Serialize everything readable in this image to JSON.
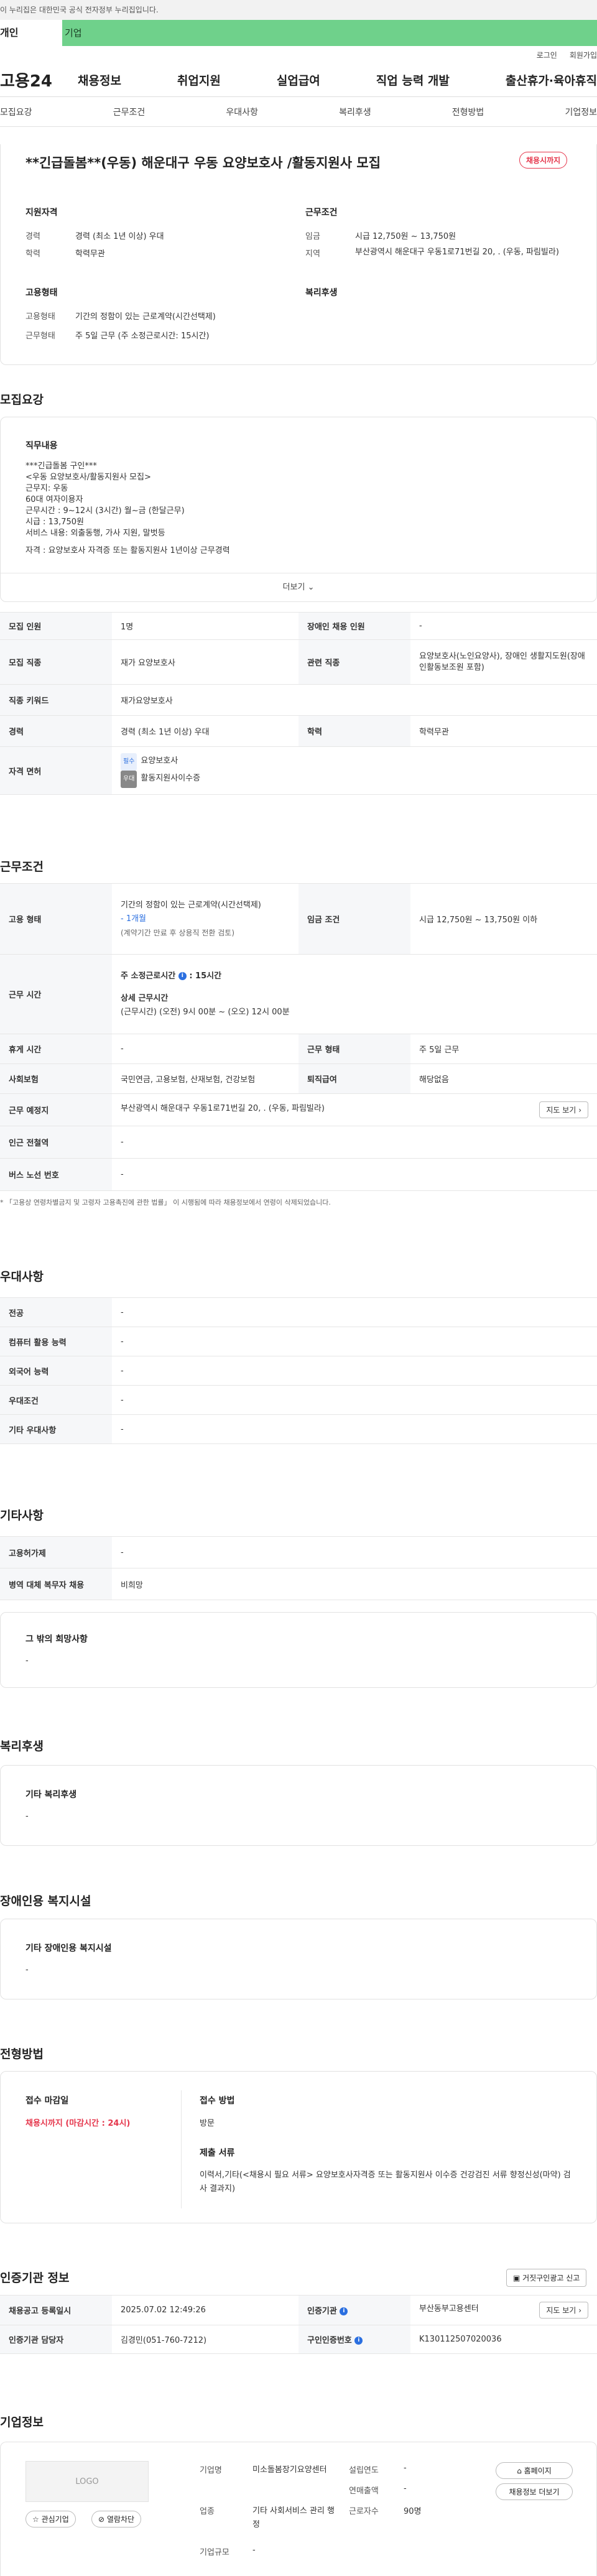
{
  "banner": {
    "text": "이 누리집은 대한민국 공식 전자정부 누리집입니다."
  },
  "tabs": {
    "personal": "개인",
    "company": "기업"
  },
  "util": {
    "login": "로그인",
    "join": "회원가입"
  },
  "gnb": {
    "logo": "고용24",
    "items": [
      "채용정보",
      "취업지원",
      "실업급여",
      "직업 능력 개발",
      "출산휴가·육아휴직"
    ]
  },
  "subtabs": [
    "모집요강",
    "근무조건",
    "우대사항",
    "복리후생",
    "전형방법",
    "기업정보"
  ],
  "job": {
    "title": "**긴급돌봄**(우동) 해운대구 우동 요양보호사 /활동지원사 모집",
    "status_badge": "채용시까지",
    "qual_head": "지원자격",
    "career_lbl": "경력",
    "career_val": "경력 (최소 1년 이상) 우대",
    "edu_lbl": "학력",
    "edu_val": "학력무관",
    "cond_head": "근무조건",
    "wage_lbl": "임금",
    "wage_val": "시급 12,750원 ~ 13,750원",
    "area_lbl": "지역",
    "area_val": "부산광역시 해운대구 우동1로71번길 20, . (우동, 파림빌라)",
    "emp_head": "고용형태",
    "emptype_lbl": "고용형태",
    "emptype_val": "기간의 정함이 있는 근로계약(시간선택제)",
    "worktype_lbl": "근무형태",
    "worktype_val": "주 5일 근무 (주 소정근로시간: 15시간)",
    "welfare_head": "복리후생"
  },
  "recruit": {
    "section_title": "모집요강",
    "duty_head": "직무내용",
    "duty_lines": [
      "***긴급돌봄 구인***",
      "<우동 요양보호사/활동지원사 모집>",
      "근무지: 우동",
      "60대 여자이용자",
      "근무시간 : 9~12시 (3시간) 월~금 (한달근무)",
      "시급 : 13,750원",
      "서비스 내용: 외출동행, 가사 지원,  말벗등",
      "",
      "자격 : 요양보호사 자격증 또는 활동지원사 1년이상 근무경력"
    ],
    "more": "더보기",
    "rows": {
      "count_lbl": "모집 인원",
      "count_val": "1명",
      "disabled_lbl": "장애인 채용 인원",
      "disabled_val": "-",
      "job_lbl": "모집 직종",
      "job_val": "재가 요양보호사",
      "related_lbl": "관련 직종",
      "related_val": "요양보호사(노인요양사), 장애인 생활지도원(장애인활동보조원 포함)",
      "keyword_lbl": "직종 키워드",
      "keyword_val": "재가요양보호사",
      "career_lbl": "경력",
      "career_val": "경력 (최소 1년 이상) 우대",
      "edu_lbl": "학력",
      "edu_val": "학력무관",
      "license_lbl": "자격 면허",
      "license_chip1": "필수",
      "license_val1": "요양보호사",
      "license_chip2": "우대",
      "license_val2": "활동지원사이수증"
    }
  },
  "conditions": {
    "section_title": "근무조건",
    "emp_lbl": "고용 형태",
    "emp_val1": "기간의 정함이 있는 근로계약(시간선택제)",
    "emp_val2": "- 1개월",
    "emp_val3": "(계약기간 만료 후 상용직 전환 검토)",
    "wage_lbl": "임금 조건",
    "wage_val": "시급 12,750원 ~ 13,750원 이하",
    "time_lbl": "근무 시간",
    "time_week": "주 소정근로시간",
    "time_week_val": ": 15시간",
    "time_detail_head": "상세 근무시간",
    "time_detail": "(근무시간) (오전) 9시 00분 ~ (오오) 12시 00분",
    "rest_lbl": "휴게 시간",
    "rest_val": "-",
    "form_lbl": "근무 형태",
    "form_val": "주 5일 근무",
    "insurance_lbl": "사회보험",
    "insurance_val": "국민연금, 고용보험, 산재보험, 건강보험",
    "retire_lbl": "퇴직급여",
    "retire_val": "해당없음",
    "place_lbl": "근무 예정지",
    "place_val": "부산광역시 해운대구 우동1로71번길 20, . (우동, 파림빌라)",
    "map_btn": "지도 보기",
    "station_lbl": "인근 전철역",
    "station_val": "-",
    "bus_lbl": "버스 노선 번호",
    "bus_val": "-",
    "note": "* 「고용상 연령차별금지 및 고령자 고용촉진에 관한 법률」 이 시행됨에 따라 채용정보에서 연령이 삭제되었습니다."
  },
  "preferences": {
    "section_title": "우대사항",
    "rows": [
      {
        "label": "전공",
        "value": "-"
      },
      {
        "label": "컴퓨터 활용 능력",
        "value": "-"
      },
      {
        "label": "외국어 능력",
        "value": "-"
      },
      {
        "label": "우대조건",
        "value": "-"
      },
      {
        "label": "기타 우대사항",
        "value": "-"
      }
    ]
  },
  "etc": {
    "section_title": "기타사항",
    "rows": [
      {
        "label": "고용허가제",
        "value": "-"
      },
      {
        "label": "병역 대체 복무자 채용",
        "value": "비희망"
      }
    ],
    "hope_head": "그 밖의 희망사항",
    "hope_val": "-"
  },
  "welfare": {
    "section_title": "복리후생",
    "head": "기타 복리후생",
    "val": "-"
  },
  "disabled_facility": {
    "section_title": "장애인용 복지시설",
    "head": "기타 장애인용 복지시설",
    "val": "-"
  },
  "process": {
    "section_title": "전형방법",
    "deadline_head": "접수 마감일",
    "deadline_val": "채용시까지 (마감시간 : 24시)",
    "method_head": "접수 방법",
    "method_val": "방문",
    "docs_head": "제출 서류",
    "docs_val": "이력서,기타(<채용시 필요 서류> 요양보호사자격증 또는  활동지원사 이수증 건강검진 서류  향정신성(마약) 검사 결과지)"
  },
  "cert": {
    "section_title": "인증기관 정보",
    "report_btn": "거짓구인광고 신고",
    "reg_lbl": "채용공고 등록일시",
    "reg_val": "2025.07.02 12:49:26",
    "agency_lbl": "인증기관",
    "agency_val": "부산동부고용센터",
    "map_btn": "지도 보기",
    "manager_lbl": "인증기관 담당자",
    "manager_val": "김경민(051-760-7212)",
    "job_no_lbl": "구인인증번호",
    "job_no_val": "K130112507020036"
  },
  "company": {
    "section_title": "기업정보",
    "logo": "LOGO",
    "interest_btn": "관심기업",
    "block_btn": "열람차단",
    "name_lbl": "기업명",
    "name_val": "미소돌봄장기요양센터",
    "industry_lbl": "업종",
    "industry_val": "기타 사회서비스 관리 행정",
    "size_lbl": "기업규모",
    "size_val": "-",
    "founded_lbl": "설립연도",
    "founded_val": "-",
    "sales_lbl": "연매출액",
    "sales_val": "-",
    "staff_lbl": "근로자수",
    "staff_val": "90명",
    "home_btn": "홈페이지",
    "jobs_btn": "채용정보 더보기"
  }
}
